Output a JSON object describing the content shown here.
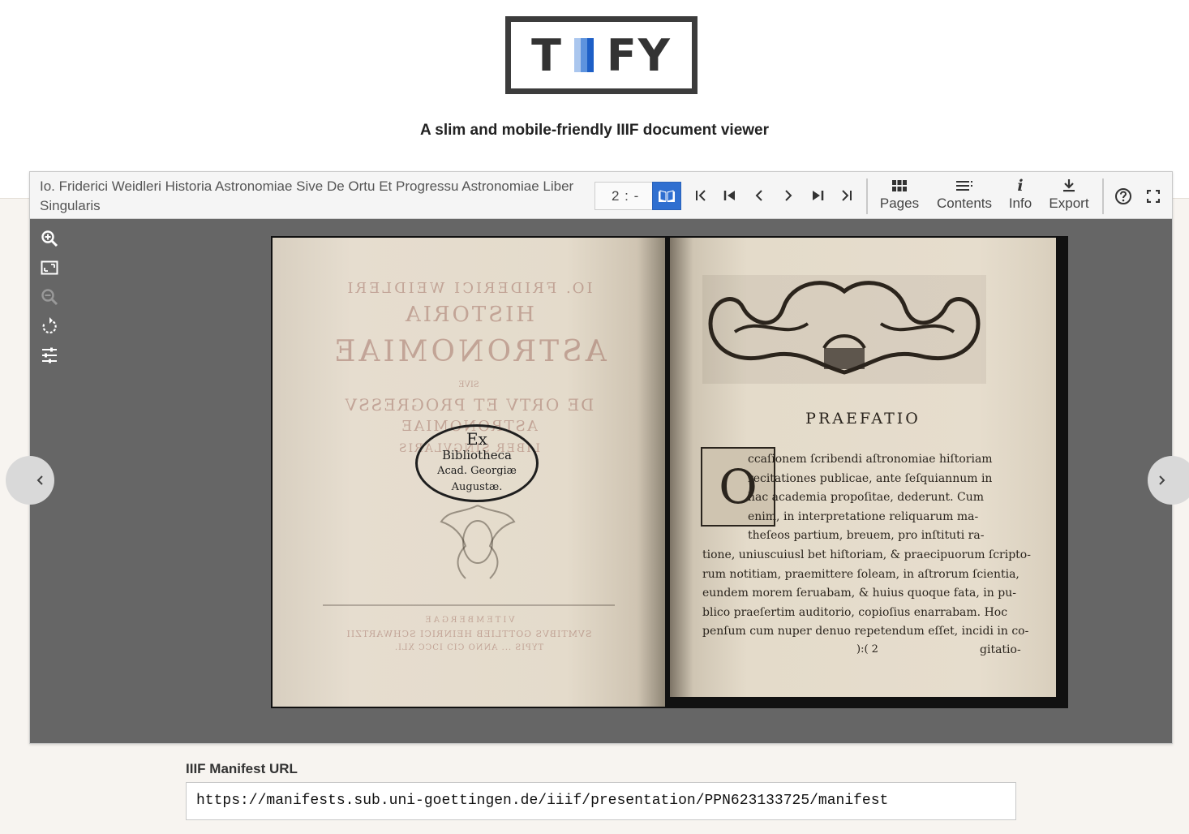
{
  "header": {
    "logo_text_t": "T",
    "logo_text_fy": "FY",
    "tagline": "A slim and mobile-friendly IIIF document viewer"
  },
  "viewer": {
    "title": "Io. Friderici Weidleri Historia Astronomiae Sive De Ortu Et Progressu Astronomiae Liber Singularis",
    "page_select": "2 : -",
    "tabs": {
      "pages": "Pages",
      "contents": "Contents",
      "info": "Info",
      "export": "Export"
    },
    "info_glyph": "i"
  },
  "scan": {
    "left_page": {
      "mirrored_lines": [
        "IO. FRIDERICI WEIDLERI",
        "HISTORIA",
        "ASTRONOMIAE",
        "SIVE",
        "DE ORTV ET PROGRESSV",
        "ASTRONOMIAE",
        "LIBER SINGVLARIS",
        "VITEMBERGAE",
        "SVMTIBVS GOTTLIEB HEINRICI SCHWARTZII",
        "TYPIS ... ANNO CIↃ IↃCC XLI."
      ],
      "stamp": [
        "Ex",
        "Bibliotheca",
        "Acad. Georgiæ",
        "Augustæ."
      ]
    },
    "right_page": {
      "heading": "PRAEFATIO",
      "drop_cap": "O",
      "lines": [
        "ccaſionem ſcribendi aſtronomiae hiſtoriam",
        "recitationes publicae, ante ſeſquiannum in",
        "hac academia propoſitae, dederunt. Cum",
        "enim, in interpretatione reliquarum ma-",
        "theſeos partium, breuem, pro inſtituti ra-",
        "tione, uniuscuiusl bet hiſtoriam, & praecipuorum ſcripto-",
        "rum notitiam, praemittere ſoleam, in aſtrorum ſcientia,",
        "eundem morem ſeruabam, & huius quoque fata, in pu-",
        "blico praeſertim auditorio, copioſius enarrabam. Hoc",
        "penſum cum nuper denuo repetendum eſſet, incidi in co-"
      ],
      "signature": "):( 2",
      "catchword": "gitatio-"
    }
  },
  "manifest": {
    "label": "IIIF Manifest URL",
    "value": "https://manifests.sub.uni-goettingen.de/iiif/presentation/PPN623133725/manifest"
  },
  "colors": {
    "accent": "#2f6fd0",
    "logo_border": "#3c3c3c",
    "viewer_bg": "#666666",
    "header_bg": "#f5f5f5"
  },
  "icons": {
    "side_tools": [
      "zoom-in-icon",
      "reset-zoom-icon",
      "zoom-out-icon",
      "rotate-icon",
      "image-filters-icon"
    ],
    "pagination": [
      "first-section-icon",
      "first-page-icon",
      "previous-page-icon",
      "next-page-icon",
      "last-page-icon",
      "last-section-icon"
    ],
    "tabs": [
      "grid-icon",
      "list-icon",
      "info-icon",
      "download-icon"
    ],
    "header_right": [
      "help-icon",
      "fullscreen-icon"
    ],
    "view_mode": "book-icon",
    "round_nav": [
      "chevron-left-icon",
      "chevron-right-icon"
    ]
  }
}
